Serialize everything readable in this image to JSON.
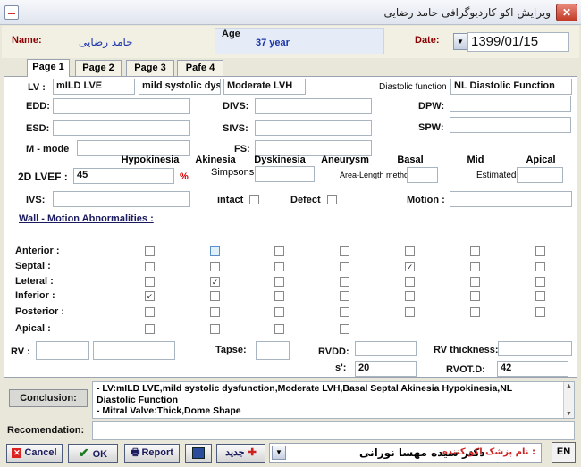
{
  "window": {
    "title": "ویرایش اکو کاردیوگرافی حامد رضایی",
    "close_glyph": "✕"
  },
  "header": {
    "name_label": "Name:",
    "name_value": "حامد رضایی",
    "age_label": "Age",
    "age_value": "37 year",
    "date_label": "Date:",
    "date_value": "1399/01/15"
  },
  "tabs": [
    "Page 1",
    "Page 2",
    "Page 3",
    "Pafe 4"
  ],
  "lv": {
    "label": "LV :",
    "v1": "mILD LVE",
    "v2": "mild systolic dysf",
    "v3": "Moderate LVH",
    "diastolic_label": "Diastolic function :",
    "diastolic_value": "NL Diastolic Function",
    "edd_label": "EDD:",
    "divs_label": "DIVS:",
    "dpw_label": "DPW:",
    "esd_label": "ESD:",
    "sivs_label": "SIVS:",
    "spw_label": "SPW:",
    "mmode_label": "M - mode",
    "fs_label": "FS:",
    "lvef_label": "2D LVEF :",
    "lvef_value": "45",
    "lvef_unit": "%",
    "simpsons_label": "Simpsons",
    "area_label": "Area-Length method:",
    "estimated_label": "Estimated:",
    "ivs_label": "IVS:",
    "intact_label": "intact",
    "defect_label": "Defect",
    "motion_label": "Motion :"
  },
  "wall": {
    "title": "Wall - Motion Abnormalities :",
    "columns": [
      "Hypokinesia",
      "Akinesia",
      "Dyskinesia",
      "Aneurysm",
      "Basal",
      "Mid",
      "Apical"
    ],
    "rows": [
      {
        "label": "Anterior :",
        "checks": [
          false,
          false,
          false,
          false,
          false,
          false,
          false
        ]
      },
      {
        "label": "Septal :",
        "checks": [
          false,
          false,
          false,
          false,
          true,
          false,
          false
        ]
      },
      {
        "label": "Leteral :",
        "checks": [
          false,
          true,
          false,
          false,
          false,
          false,
          false
        ]
      },
      {
        "label": "Inferior :",
        "checks": [
          true,
          false,
          false,
          false,
          false,
          false,
          false
        ]
      },
      {
        "label": "Posterior :",
        "checks": [
          false,
          false,
          false,
          false,
          false,
          false,
          false
        ]
      },
      {
        "label": "Apical :",
        "checks": [
          false,
          false,
          false,
          false,
          null,
          null,
          null
        ]
      }
    ]
  },
  "rv": {
    "rv_label": "RV :",
    "tapse_label": "Tapse:",
    "rvdd_label": "RVDD:",
    "rv_thickness_label": "RV thickness:",
    "s_label": "s':",
    "s_value": "20",
    "rvotd_label": "RVOT.D:",
    "rvotd_value": "42"
  },
  "conclusion": {
    "label": "Conclusion:",
    "line1": "- LV:mILD LVE,mild systolic dysfunction,Moderate LVH,Basal Septal   Akinesia Hypokinesia,NL",
    "line2": "Diastolic Function",
    "line3": "- Mitral Valve:Thick,Dome Shape"
  },
  "recommendation": {
    "label": "Recomendation:",
    "value": ""
  },
  "footer": {
    "cancel": "Cancel",
    "ok": "OK",
    "report": "Report",
    "new": "جدید",
    "doctor_label": "نام پزشک اکو کننده :",
    "doctor_value": "دکتر سیده مهسا نورانی",
    "lang": "EN"
  }
}
